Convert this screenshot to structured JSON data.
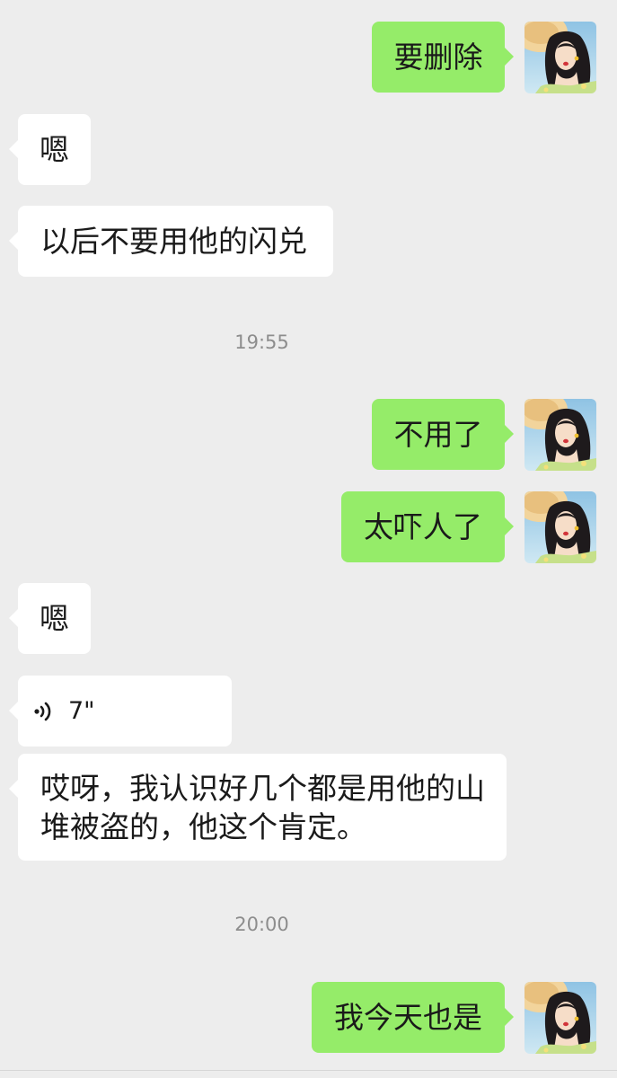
{
  "messages": [
    {
      "side": "out",
      "text": "要删除"
    },
    {
      "side": "in",
      "text": "嗯"
    },
    {
      "side": "in",
      "text": "以后不要用他的闪兑"
    },
    {
      "side": "in",
      "text": "嗯"
    },
    {
      "side": "in",
      "type": "voice",
      "duration": "7\""
    },
    {
      "side": "in",
      "text": "哎呀，我认识好几个都是用他的山堆被盗的，他这个肯定。"
    },
    {
      "side": "out",
      "text": "不用了"
    },
    {
      "side": "out",
      "text": "太吓人了"
    },
    {
      "side": "out",
      "text": "我今天也是"
    }
  ],
  "timestamps": [
    "19:55",
    "20:00"
  ],
  "colors": {
    "background": "#ededed",
    "incoming_bubble": "#ffffff",
    "outgoing_bubble": "#95ec69",
    "timestamp_text": "#8d8d8d"
  },
  "icons": {
    "voice": "voice-wave-icon",
    "avatar": "user-avatar"
  }
}
